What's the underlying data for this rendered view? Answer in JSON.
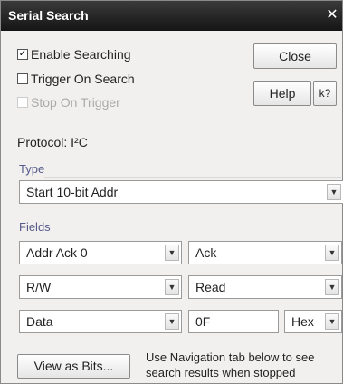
{
  "window": {
    "title": "Serial Search",
    "close_glyph": "✕"
  },
  "options": {
    "enable_searching": {
      "label": "Enable Searching",
      "checked": true
    },
    "trigger_on_search": {
      "label": "Trigger On Search",
      "checked": false
    },
    "stop_on_trigger": {
      "label": "Stop On Trigger",
      "checked": false,
      "disabled": true
    }
  },
  "buttons": {
    "close": "Close",
    "help": "Help",
    "whats_this": "k?"
  },
  "protocol": {
    "label": "Protocol:",
    "value": "I²C"
  },
  "type": {
    "heading": "Type",
    "selected": "Start 10-bit Addr"
  },
  "fields": {
    "heading": "Fields",
    "rows": [
      {
        "left": "Addr Ack 0",
        "right": "Ack"
      },
      {
        "left": "R/W",
        "right": "Read"
      },
      {
        "left": "Data",
        "value": "0F",
        "format": "Hex"
      }
    ]
  },
  "footer": {
    "view_bits": "View as Bits...",
    "hint_line1": "Use Navigation tab below to see",
    "hint_line2": "search results when stopped"
  },
  "colors": {
    "titlebar": "#1e1e1e",
    "section_heading": "#555a8a",
    "window_bg": "#f1f0ee"
  }
}
